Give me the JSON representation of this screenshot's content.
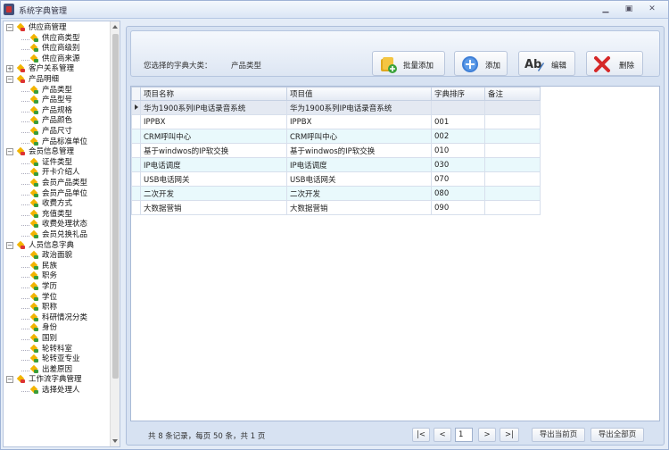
{
  "window": {
    "title": "系统字典管理"
  },
  "tree": {
    "nodes": [
      {
        "label": "供应商管理",
        "level": 0,
        "expand": "−"
      },
      {
        "label": "供应商类型",
        "level": 1
      },
      {
        "label": "供应商级别",
        "level": 1
      },
      {
        "label": "供应商来源",
        "level": 1
      },
      {
        "label": "客户关系管理",
        "level": 0,
        "expand": "+"
      },
      {
        "label": "产品明细",
        "level": 0,
        "expand": "−"
      },
      {
        "label": "产品类型",
        "level": 1
      },
      {
        "label": "产品型号",
        "level": 1
      },
      {
        "label": "产品规格",
        "level": 1
      },
      {
        "label": "产品颜色",
        "level": 1
      },
      {
        "label": "产品尺寸",
        "level": 1
      },
      {
        "label": "产品标准单位",
        "level": 1
      },
      {
        "label": "会员信息管理",
        "level": 0,
        "expand": "−"
      },
      {
        "label": "证件类型",
        "level": 1
      },
      {
        "label": "开卡介绍人",
        "level": 1
      },
      {
        "label": "会员产品类型",
        "level": 1
      },
      {
        "label": "会员产品单位",
        "level": 1
      },
      {
        "label": "收费方式",
        "level": 1
      },
      {
        "label": "充值类型",
        "level": 1
      },
      {
        "label": "收费处理状态",
        "level": 1
      },
      {
        "label": "会员兑换礼品",
        "level": 1
      },
      {
        "label": "人员信息字典",
        "level": 0,
        "expand": "−"
      },
      {
        "label": "政治面貌",
        "level": 1
      },
      {
        "label": "民族",
        "level": 1
      },
      {
        "label": "职务",
        "level": 1
      },
      {
        "label": "学历",
        "level": 1
      },
      {
        "label": "学位",
        "level": 1
      },
      {
        "label": "职称",
        "level": 1
      },
      {
        "label": "科研情况分类",
        "level": 1
      },
      {
        "label": "身份",
        "level": 1
      },
      {
        "label": "国别",
        "level": 1
      },
      {
        "label": "轮转科室",
        "level": 1
      },
      {
        "label": "轮转亚专业",
        "level": 1
      },
      {
        "label": "出差原因",
        "level": 1
      },
      {
        "label": "工作流字典管理",
        "level": 0,
        "expand": "−"
      },
      {
        "label": "选择处理人",
        "level": 1
      }
    ]
  },
  "toolbar": {
    "dict_label": "您选择的字典大类：",
    "dict_value": "产品类型",
    "batch_add": "批量添加",
    "add": "添加",
    "edit": "编辑",
    "delete": "删除"
  },
  "grid": {
    "columns": [
      "项目名称",
      "项目值",
      "字典排序",
      "备注"
    ],
    "rows": [
      {
        "name": "华为1900系列IP电话录音系统",
        "value": "华为1900系列IP电话录音系统",
        "order": "",
        "note": ""
      },
      {
        "name": "IPPBX",
        "value": "IPPBX",
        "order": "001",
        "note": ""
      },
      {
        "name": "CRM呼叫中心",
        "value": "CRM呼叫中心",
        "order": "002",
        "note": ""
      },
      {
        "name": "基于windwos的IP软交换",
        "value": "基于windwos的IP软交换",
        "order": "010",
        "note": ""
      },
      {
        "name": "IP电话调度",
        "value": "IP电话调度",
        "order": "030",
        "note": ""
      },
      {
        "name": "USB电话网关",
        "value": "USB电话网关",
        "order": "070",
        "note": ""
      },
      {
        "name": "二次开发",
        "value": "二次开发",
        "order": "080",
        "note": ""
      },
      {
        "name": "大数据营销",
        "value": "大数据营销",
        "order": "090",
        "note": ""
      }
    ]
  },
  "pager": {
    "info": "共 8 条记录，每页 50 条，共 1 页",
    "first": "|<",
    "prev": "<",
    "page": "1",
    "next": ">",
    "last": ">|",
    "export_current": "导出当前页",
    "export_all": "导出全部页"
  }
}
